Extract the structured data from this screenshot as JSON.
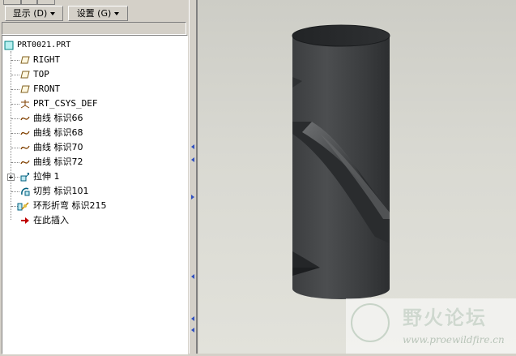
{
  "toolbar": {
    "show_label": "显示 (D)",
    "settings_label": "设置 (G)"
  },
  "tree": {
    "root": "PRT0021.PRT",
    "items": [
      {
        "label": "RIGHT",
        "icon": "datum-plane-icon"
      },
      {
        "label": "TOP",
        "icon": "datum-plane-icon"
      },
      {
        "label": "FRONT",
        "icon": "datum-plane-icon"
      },
      {
        "label": "PRT_CSYS_DEF",
        "icon": "coordinate-system-icon"
      },
      {
        "label": "曲线 标识66",
        "icon": "curve-icon"
      },
      {
        "label": "曲线 标识68",
        "icon": "curve-icon"
      },
      {
        "label": "曲线 标识70",
        "icon": "curve-icon"
      },
      {
        "label": "曲线 标识72",
        "icon": "curve-icon"
      },
      {
        "label": "拉伸 1",
        "icon": "extrude-icon"
      },
      {
        "label": "切剪 标识101",
        "icon": "cut-icon"
      },
      {
        "label": "环形折弯 标识215",
        "icon": "toroidal-bend-icon"
      },
      {
        "label": "在此插入",
        "icon": "insert-here-arrow-icon"
      }
    ]
  },
  "watermark": {
    "title": "野火论坛",
    "url": "www.proewildfire.cn"
  },
  "colors": {
    "insert_arrow": "#c00000",
    "tree_bg": "#ffffff",
    "panel": "#d4d0c8"
  }
}
